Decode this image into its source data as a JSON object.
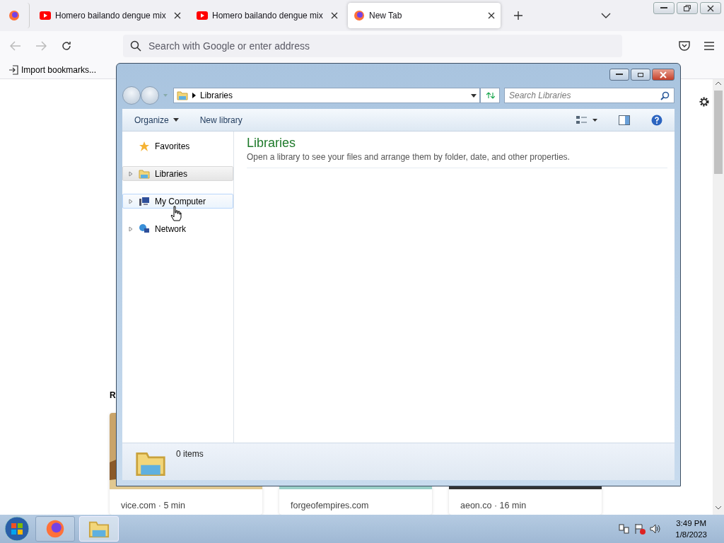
{
  "browser": {
    "tabs": [
      {
        "kind": "pinned",
        "selected": false
      },
      {
        "kind": "youtube",
        "title": "Homero bailando dengue mix",
        "selected": false
      },
      {
        "kind": "youtube",
        "title": "Homero bailando dengue mix",
        "selected": false
      },
      {
        "kind": "firefox",
        "title": "New Tab",
        "selected": true
      }
    ],
    "address": {
      "placeholder": "Search with Google or enter address"
    },
    "bookmarks": [
      "Import bookmarks..."
    ],
    "recent": {
      "heading": "R",
      "cards": [
        {
          "caption": "vice.com · 5 min"
        },
        {
          "caption": "forgeofempires.com"
        },
        {
          "caption": "aeon.co · 16 min"
        }
      ]
    }
  },
  "explorer": {
    "breadcrumb": "Libraries",
    "search": {
      "placeholder": "Search Libraries"
    },
    "commands": [
      {
        "label": "Organize",
        "dropdown": true
      },
      {
        "label": "New library",
        "dropdown": false
      }
    ],
    "nav": [
      {
        "kind": "favorites",
        "label": "Favorites",
        "expandable": false,
        "selected": false,
        "hovered": false
      },
      {
        "kind": "libraries",
        "label": "Libraries",
        "expandable": true,
        "selected": true,
        "hovered": false
      },
      {
        "kind": "computer",
        "label": "My Computer",
        "expandable": true,
        "selected": false,
        "hovered": true
      },
      {
        "kind": "network",
        "label": "Network",
        "expandable": true,
        "selected": false,
        "hovered": false
      }
    ],
    "title": "Libraries",
    "description": "Open a library to see your files and arrange them by folder, date, and other properties.",
    "status": "0 items"
  },
  "taskbar": {
    "apps": [
      {
        "kind": "firefox",
        "active": false
      },
      {
        "kind": "explorer",
        "active": true
      }
    ],
    "time": "3:49 PM",
    "date": "1/8/2023"
  }
}
